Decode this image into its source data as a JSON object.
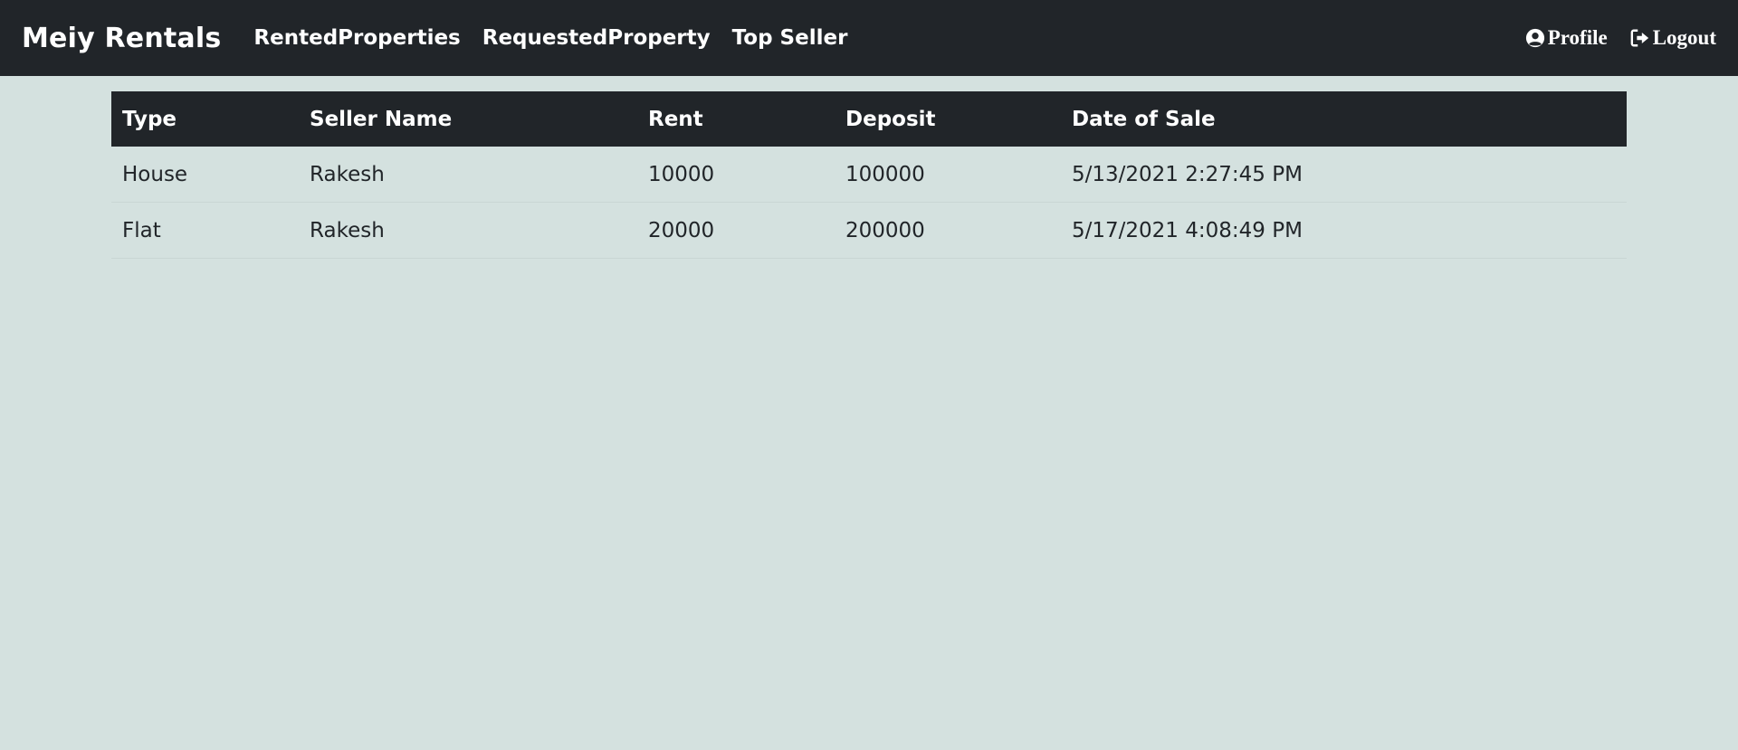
{
  "navbar": {
    "brand": "Meiy Rentals",
    "links": [
      "RentedProperties",
      "RequestedProperty",
      "Top Seller"
    ],
    "profile_label": "Profile",
    "logout_label": "Logout",
    "profile_icon": "user-circle-icon",
    "logout_icon": "sign-out-icon"
  },
  "table": {
    "headers": [
      "Type",
      "Seller Name",
      "Rent",
      "Deposit",
      "Date of Sale"
    ],
    "rows": [
      [
        "House",
        "Rakesh",
        "10000",
        "100000",
        "5/13/2021 2:27:45 PM"
      ],
      [
        "Flat",
        "Rakesh",
        "20000",
        "200000",
        "5/17/2021 4:08:49 PM"
      ]
    ]
  },
  "colors": {
    "navbar_bg": "#212529",
    "page_bg": "#d4e1df",
    "header_text": "#ffffff",
    "body_text": "#212529"
  }
}
